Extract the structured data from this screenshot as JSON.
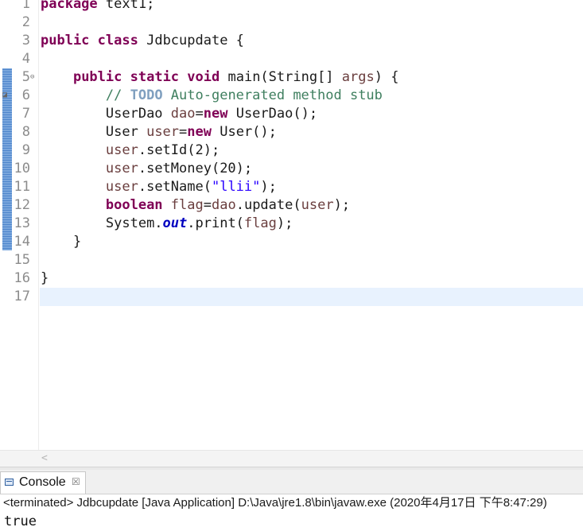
{
  "editor": {
    "line_numbers": [
      "1",
      "2",
      "3",
      "4",
      "5",
      "6",
      "7",
      "8",
      "9",
      "10",
      "11",
      "12",
      "13",
      "14",
      "15",
      "16",
      "17"
    ],
    "lines": {
      "l1": {
        "kw": "package",
        "rest": " text1;"
      },
      "l3": {
        "kw1": "public",
        "kw2": "class",
        "rest": " Jdbcupdate {"
      },
      "l5": {
        "kw1": "public",
        "kw2": "static",
        "kw3": "void",
        "rest": " main(String[] ",
        "var": "args",
        "end": ") {"
      },
      "l6": {
        "slashes": "// ",
        "todo": "TODO",
        "rest": " Auto-generated method stub"
      },
      "l7": {
        "type": "UserDao ",
        "var": "dao",
        "eq": "=",
        "kw": "new",
        "rest": " UserDao();"
      },
      "l8": {
        "type": "User ",
        "var": "user",
        "eq": "=",
        "kw": "new",
        "rest": " User();"
      },
      "l9": {
        "var": "user",
        "rest": ".setId(2);"
      },
      "l10": {
        "var": "user",
        "rest": ".setMoney(20);"
      },
      "l11": {
        "var": "user",
        "mid": ".setName(",
        "str": "\"llii\"",
        "end": ");"
      },
      "l12": {
        "kw": "boolean",
        "sp": " ",
        "var": "flag",
        "eq": "=",
        "var2": "dao",
        "mid": ".update(",
        "var3": "user",
        "end": ");"
      },
      "l13": {
        "pre": "System.",
        "fld": "out",
        "mid": ".print(",
        "var": "flag",
        "end": ");"
      },
      "l14": {
        "text": "}"
      },
      "l16": {
        "text": "}"
      }
    },
    "colors": {
      "keyword": "#7f0055",
      "comment": "#3f7f5f",
      "string": "#2a00ff",
      "field": "#0000c0",
      "variable": "#6a3e3e",
      "current_line": "#e8f2fe"
    }
  },
  "console": {
    "tab_label": "Console",
    "tab_close_symbol": "☒",
    "status": "<terminated> Jdbcupdate [Java Application] D:\\Java\\jre1.8\\bin\\javaw.exe (2020年4月17日 下午8:47:29)",
    "output": "true"
  },
  "scroll": {
    "left_arrow": "<"
  }
}
